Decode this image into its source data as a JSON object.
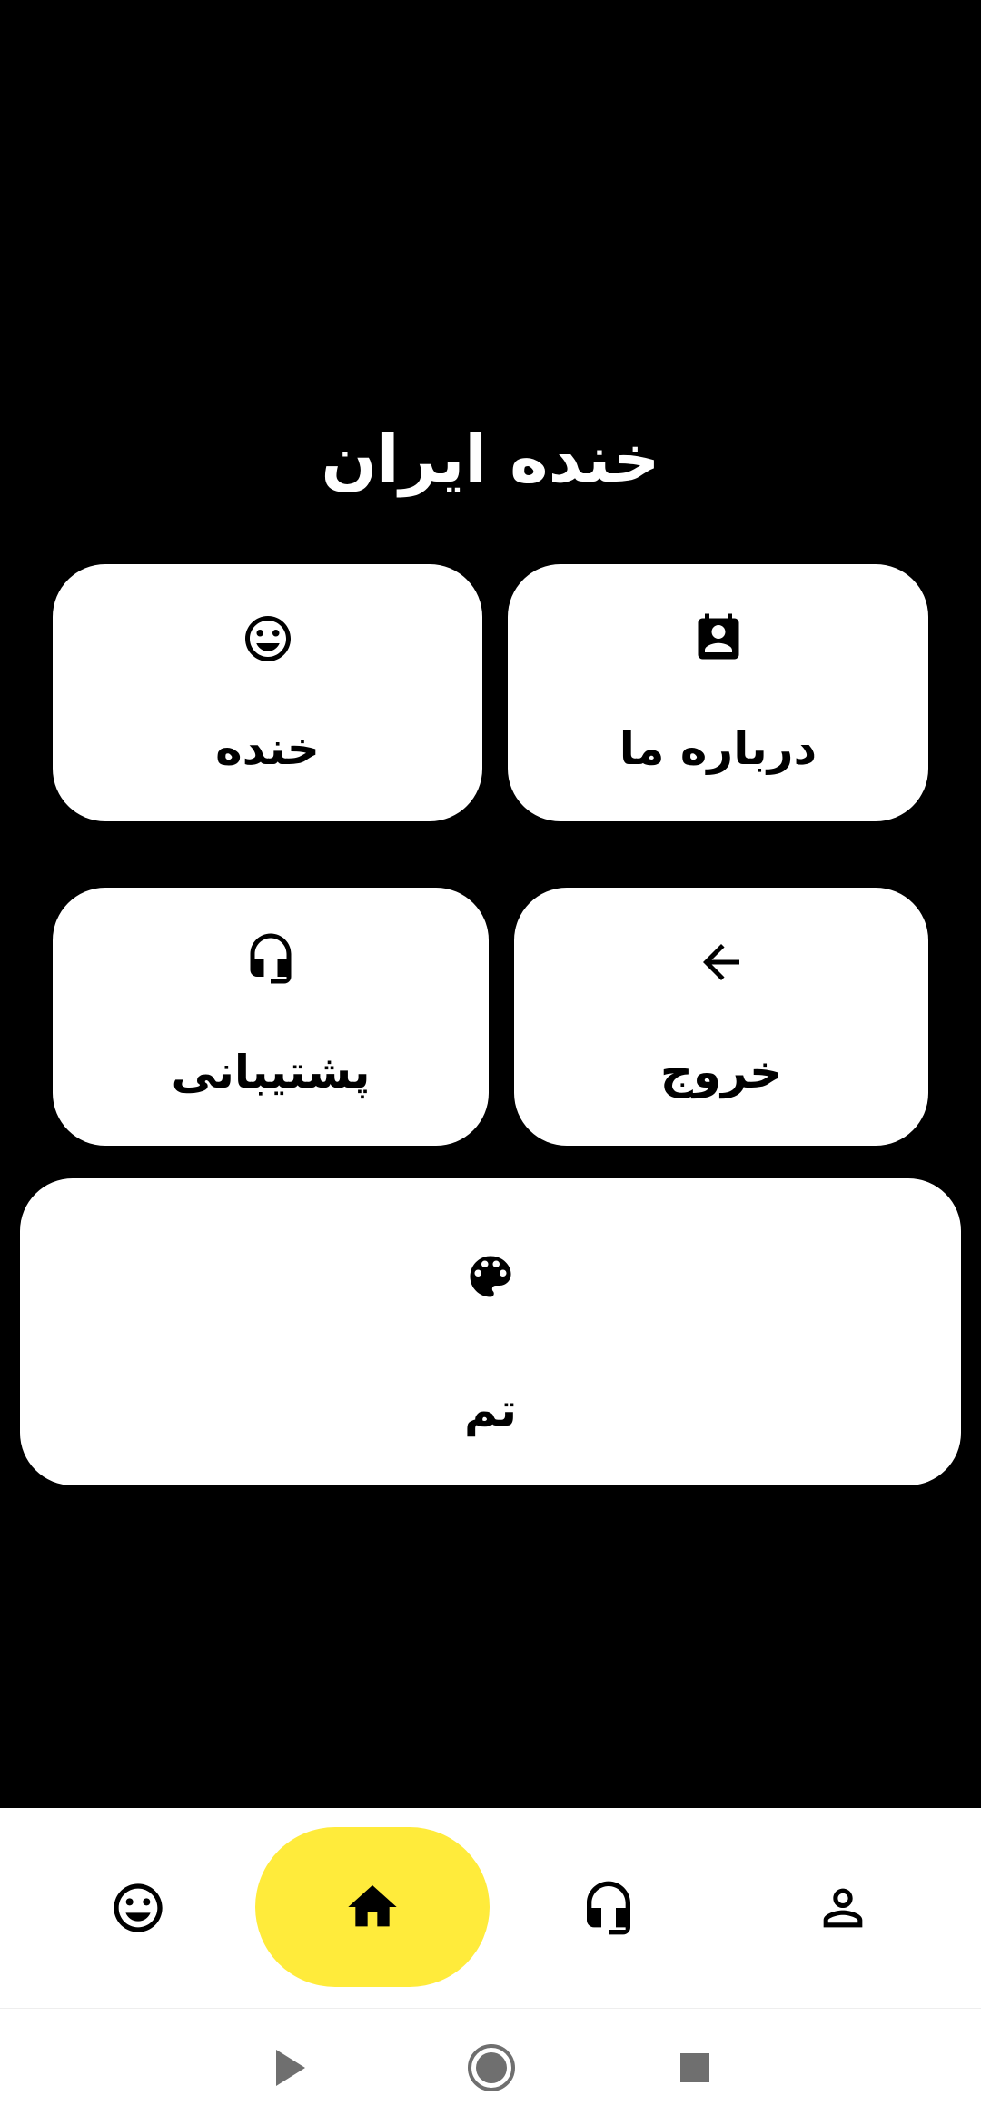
{
  "app": {
    "title": "خنده ایران"
  },
  "menu": {
    "about": {
      "label": "درباره ما",
      "icon": "contact-card-icon"
    },
    "laugh": {
      "label": "خنده",
      "icon": "smiley-icon"
    },
    "exit": {
      "label": "خروج",
      "icon": "arrow-left-icon"
    },
    "support": {
      "label": "پشتیبانی",
      "icon": "headset-icon"
    },
    "theme": {
      "label": "تم",
      "icon": "palette-icon"
    }
  },
  "bottom_nav": {
    "items": [
      {
        "icon": "smiley-icon",
        "active": false
      },
      {
        "icon": "home-icon",
        "active": true
      },
      {
        "icon": "headset-icon",
        "active": false
      },
      {
        "icon": "person-icon",
        "active": false
      }
    ],
    "active_color": "#ffeb3b"
  },
  "system_nav": {
    "buttons": [
      "back-icon",
      "home-circle-icon",
      "recents-icon"
    ]
  },
  "colors": {
    "background": "#000000",
    "card": "#ffffff",
    "accent": "#ffeb3b"
  }
}
